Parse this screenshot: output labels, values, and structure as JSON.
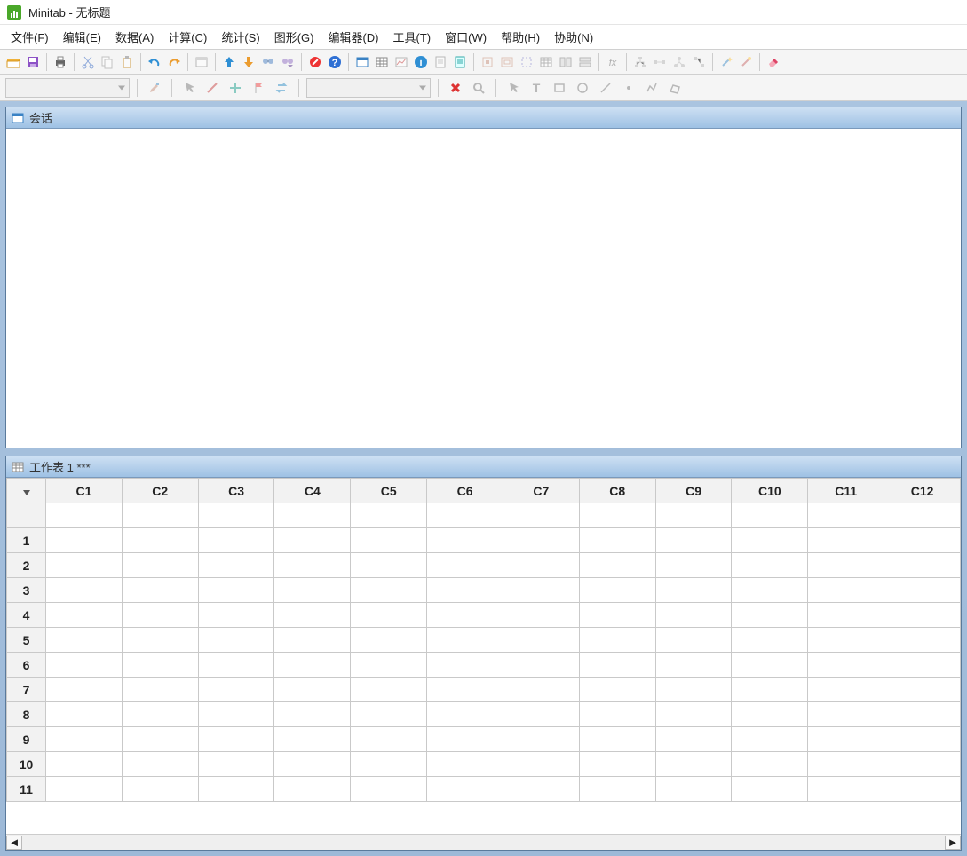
{
  "app": {
    "name": "Minitab",
    "doc": "无标题"
  },
  "menu": [
    "文件(F)",
    "编辑(E)",
    "数据(A)",
    "计算(C)",
    "统计(S)",
    "图形(G)",
    "编辑器(D)",
    "工具(T)",
    "窗口(W)",
    "帮助(H)",
    "协助(N)"
  ],
  "panes": {
    "session": {
      "title": "会话"
    },
    "worksheet": {
      "title": "工作表 1 ***"
    }
  },
  "columns": [
    "C1",
    "C2",
    "C3",
    "C4",
    "C5",
    "C6",
    "C7",
    "C8",
    "C9",
    "C10",
    "C11",
    "C12"
  ],
  "rows": [
    "1",
    "2",
    "3",
    "4",
    "5",
    "6",
    "7",
    "8",
    "9",
    "10",
    "11"
  ],
  "icons": {
    "open": "open",
    "save": "save",
    "print": "print",
    "cut": "cut",
    "copy": "copy",
    "paste": "paste",
    "undo": "undo",
    "redo": "redo",
    "newwin": "newwin",
    "up": "up",
    "down": "down",
    "binoc": "binoc",
    "binoc2": "binoc2",
    "cancel": "cancel",
    "help": "help",
    "win1": "win1",
    "win2": "win2",
    "win3": "win3",
    "info": "info",
    "doc": "doc",
    "note": "note",
    "a1": "a1",
    "a2": "a2",
    "a3": "a3",
    "a4": "a4",
    "a5": "a5",
    "a6": "a6",
    "fx": "fx",
    "d1": "d1",
    "d2": "d2",
    "d3": "d3",
    "d4": "d4",
    "wand": "wand",
    "wand2": "wand2",
    "eraser": "eraser",
    "brush": "brush",
    "pointer": "pointer",
    "pen": "pen",
    "plus": "plus",
    "flag": "flag",
    "swap": "swap",
    "delx": "delx",
    "zoom": "zoom",
    "pointer2": "pointer2",
    "text": "text",
    "rect": "rect",
    "circle": "circle",
    "line": "line",
    "dot": "dot",
    "poly": "poly",
    "mark": "mark"
  }
}
